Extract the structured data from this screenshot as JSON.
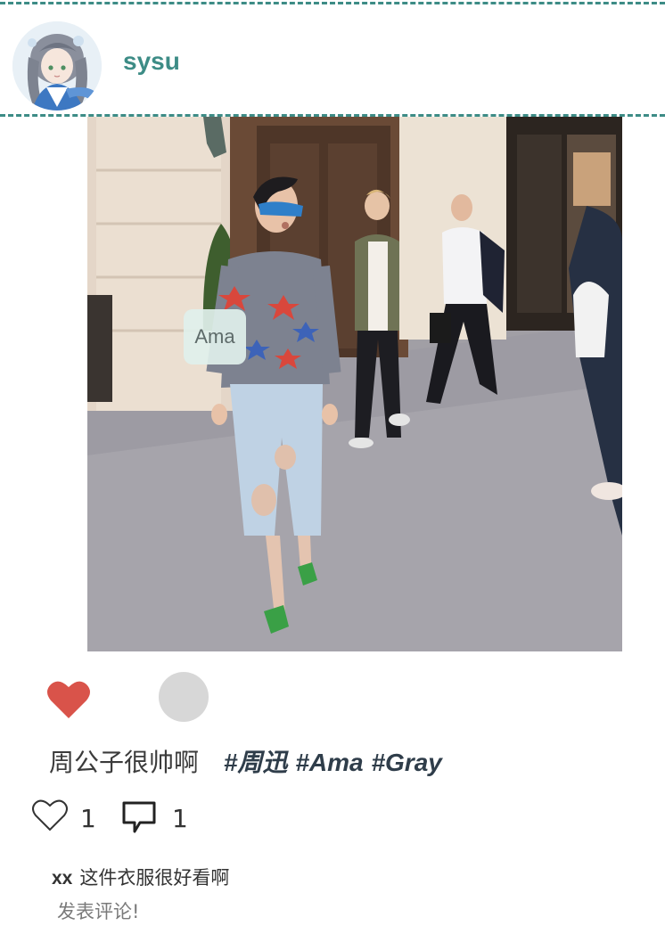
{
  "colors": {
    "accent": "#3d8c86",
    "like_filled": "#d9534a",
    "tag_text": "#2f3d4a"
  },
  "post": {
    "username": "sysu",
    "photo_tag": "Ama",
    "caption": {
      "text": "周公子很帅啊",
      "hashtags": [
        "#周迅",
        "#Ama",
        "#Gray"
      ]
    },
    "like_count": "1",
    "comment_count": "1",
    "comments": [
      {
        "user": "xx",
        "text": "这件衣服很好看啊"
      }
    ],
    "add_comment_label": "发表评论!"
  },
  "icons": {
    "like_button": "heart-filled-icon",
    "like_stat": "heart-outline-icon",
    "comment_stat": "speech-bubble-icon"
  }
}
